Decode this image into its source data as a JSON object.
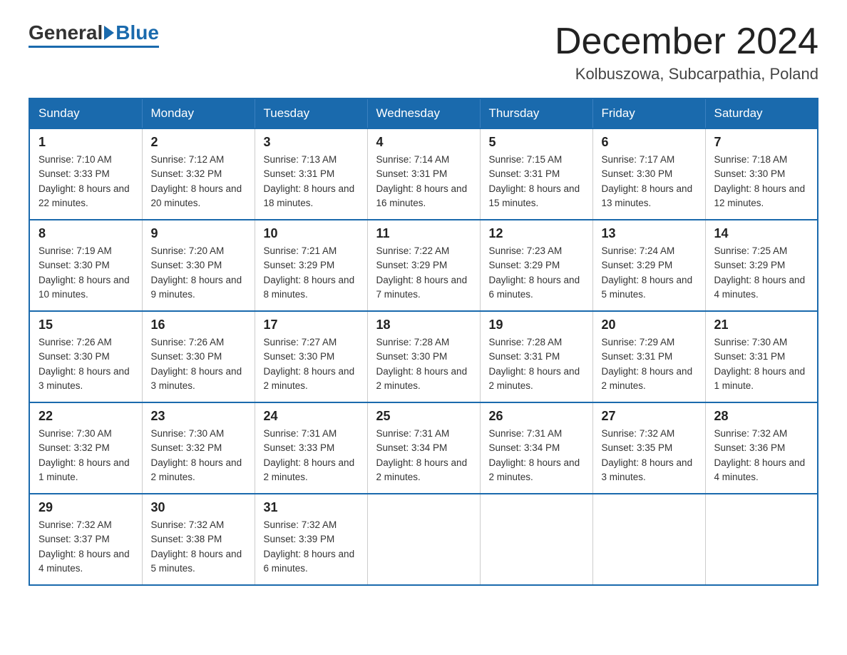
{
  "header": {
    "logo_general": "General",
    "logo_blue": "Blue",
    "main_title": "December 2024",
    "subtitle": "Kolbuszowa, Subcarpathia, Poland"
  },
  "days_of_week": [
    "Sunday",
    "Monday",
    "Tuesday",
    "Wednesday",
    "Thursday",
    "Friday",
    "Saturday"
  ],
  "weeks": [
    [
      {
        "day": "1",
        "sunrise": "7:10 AM",
        "sunset": "3:33 PM",
        "daylight": "8 hours and 22 minutes."
      },
      {
        "day": "2",
        "sunrise": "7:12 AM",
        "sunset": "3:32 PM",
        "daylight": "8 hours and 20 minutes."
      },
      {
        "day": "3",
        "sunrise": "7:13 AM",
        "sunset": "3:31 PM",
        "daylight": "8 hours and 18 minutes."
      },
      {
        "day": "4",
        "sunrise": "7:14 AM",
        "sunset": "3:31 PM",
        "daylight": "8 hours and 16 minutes."
      },
      {
        "day": "5",
        "sunrise": "7:15 AM",
        "sunset": "3:31 PM",
        "daylight": "8 hours and 15 minutes."
      },
      {
        "day": "6",
        "sunrise": "7:17 AM",
        "sunset": "3:30 PM",
        "daylight": "8 hours and 13 minutes."
      },
      {
        "day": "7",
        "sunrise": "7:18 AM",
        "sunset": "3:30 PM",
        "daylight": "8 hours and 12 minutes."
      }
    ],
    [
      {
        "day": "8",
        "sunrise": "7:19 AM",
        "sunset": "3:30 PM",
        "daylight": "8 hours and 10 minutes."
      },
      {
        "day": "9",
        "sunrise": "7:20 AM",
        "sunset": "3:30 PM",
        "daylight": "8 hours and 9 minutes."
      },
      {
        "day": "10",
        "sunrise": "7:21 AM",
        "sunset": "3:29 PM",
        "daylight": "8 hours and 8 minutes."
      },
      {
        "day": "11",
        "sunrise": "7:22 AM",
        "sunset": "3:29 PM",
        "daylight": "8 hours and 7 minutes."
      },
      {
        "day": "12",
        "sunrise": "7:23 AM",
        "sunset": "3:29 PM",
        "daylight": "8 hours and 6 minutes."
      },
      {
        "day": "13",
        "sunrise": "7:24 AM",
        "sunset": "3:29 PM",
        "daylight": "8 hours and 5 minutes."
      },
      {
        "day": "14",
        "sunrise": "7:25 AM",
        "sunset": "3:29 PM",
        "daylight": "8 hours and 4 minutes."
      }
    ],
    [
      {
        "day": "15",
        "sunrise": "7:26 AM",
        "sunset": "3:30 PM",
        "daylight": "8 hours and 3 minutes."
      },
      {
        "day": "16",
        "sunrise": "7:26 AM",
        "sunset": "3:30 PM",
        "daylight": "8 hours and 3 minutes."
      },
      {
        "day": "17",
        "sunrise": "7:27 AM",
        "sunset": "3:30 PM",
        "daylight": "8 hours and 2 minutes."
      },
      {
        "day": "18",
        "sunrise": "7:28 AM",
        "sunset": "3:30 PM",
        "daylight": "8 hours and 2 minutes."
      },
      {
        "day": "19",
        "sunrise": "7:28 AM",
        "sunset": "3:31 PM",
        "daylight": "8 hours and 2 minutes."
      },
      {
        "day": "20",
        "sunrise": "7:29 AM",
        "sunset": "3:31 PM",
        "daylight": "8 hours and 2 minutes."
      },
      {
        "day": "21",
        "sunrise": "7:30 AM",
        "sunset": "3:31 PM",
        "daylight": "8 hours and 1 minute."
      }
    ],
    [
      {
        "day": "22",
        "sunrise": "7:30 AM",
        "sunset": "3:32 PM",
        "daylight": "8 hours and 1 minute."
      },
      {
        "day": "23",
        "sunrise": "7:30 AM",
        "sunset": "3:32 PM",
        "daylight": "8 hours and 2 minutes."
      },
      {
        "day": "24",
        "sunrise": "7:31 AM",
        "sunset": "3:33 PM",
        "daylight": "8 hours and 2 minutes."
      },
      {
        "day": "25",
        "sunrise": "7:31 AM",
        "sunset": "3:34 PM",
        "daylight": "8 hours and 2 minutes."
      },
      {
        "day": "26",
        "sunrise": "7:31 AM",
        "sunset": "3:34 PM",
        "daylight": "8 hours and 2 minutes."
      },
      {
        "day": "27",
        "sunrise": "7:32 AM",
        "sunset": "3:35 PM",
        "daylight": "8 hours and 3 minutes."
      },
      {
        "day": "28",
        "sunrise": "7:32 AM",
        "sunset": "3:36 PM",
        "daylight": "8 hours and 4 minutes."
      }
    ],
    [
      {
        "day": "29",
        "sunrise": "7:32 AM",
        "sunset": "3:37 PM",
        "daylight": "8 hours and 4 minutes."
      },
      {
        "day": "30",
        "sunrise": "7:32 AM",
        "sunset": "3:38 PM",
        "daylight": "8 hours and 5 minutes."
      },
      {
        "day": "31",
        "sunrise": "7:32 AM",
        "sunset": "3:39 PM",
        "daylight": "8 hours and 6 minutes."
      },
      null,
      null,
      null,
      null
    ]
  ],
  "labels": {
    "sunrise": "Sunrise:",
    "sunset": "Sunset:",
    "daylight": "Daylight:"
  }
}
